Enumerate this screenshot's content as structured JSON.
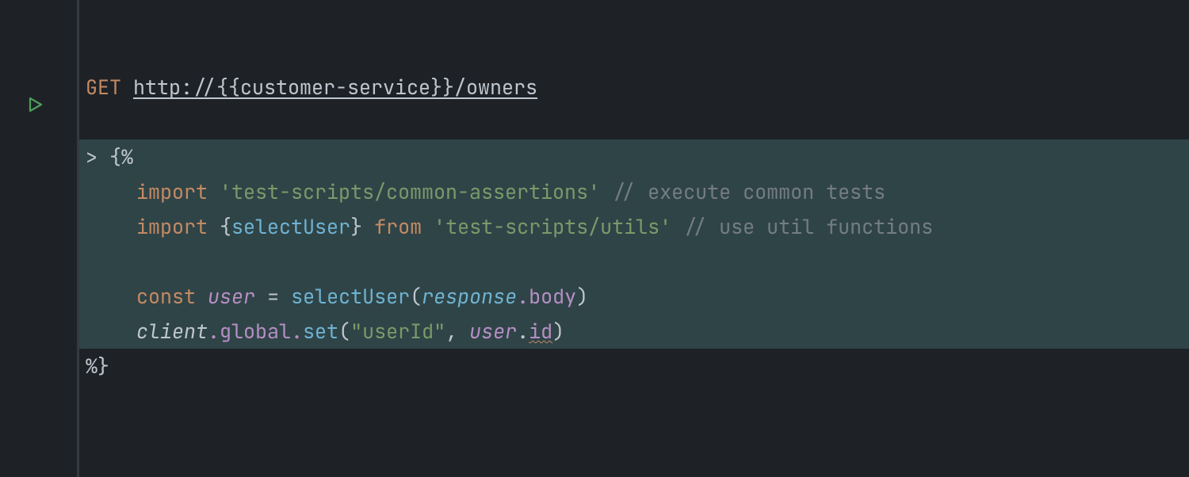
{
  "editor": {
    "request": {
      "method": "GET",
      "url": "http://{{customer-service}}/owners"
    },
    "script": {
      "open_tag": "> {%",
      "close_tag": "%}",
      "lines": {
        "import1": {
          "kw": "import",
          "str": "'test-scripts/common-assertions'",
          "comment": "// execute common tests"
        },
        "import2": {
          "kw": "import",
          "lbrace": "{",
          "ident": "selectUser",
          "rbrace": "}",
          "from": "from",
          "str": "'test-scripts/utils'",
          "comment": "// use util functions"
        },
        "const_line": {
          "kw": "const",
          "varname": "user",
          "eq": "=",
          "fn": "selectUser",
          "arg_obj": "response",
          "arg_prop": ".body"
        },
        "client_line": {
          "obj": "client",
          "chain1": ".global.",
          "fn": "set",
          "str": "\"userId\"",
          "comma": ",",
          "var": "user",
          "dot": ".",
          "prop": "id"
        }
      }
    }
  }
}
